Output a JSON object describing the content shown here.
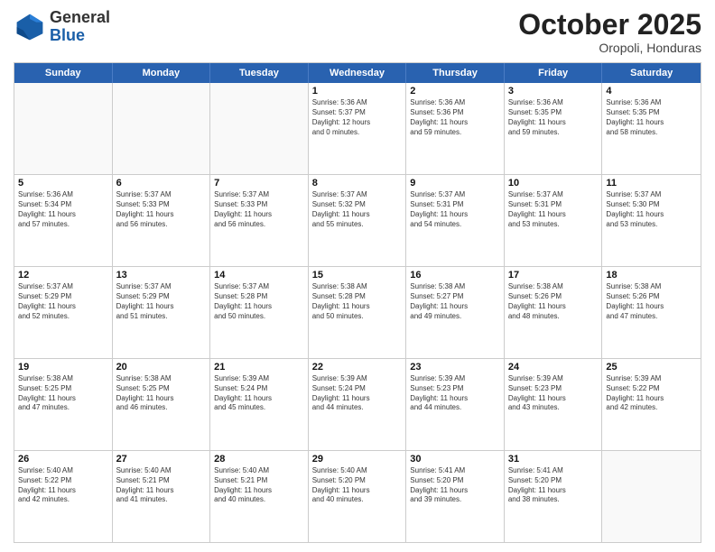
{
  "header": {
    "logo_general": "General",
    "logo_blue": "Blue",
    "month": "October 2025",
    "location": "Oropoli, Honduras"
  },
  "weekdays": [
    "Sunday",
    "Monday",
    "Tuesday",
    "Wednesday",
    "Thursday",
    "Friday",
    "Saturday"
  ],
  "rows": [
    [
      {
        "day": "",
        "text": "",
        "empty": true
      },
      {
        "day": "",
        "text": "",
        "empty": true
      },
      {
        "day": "",
        "text": "",
        "empty": true
      },
      {
        "day": "1",
        "text": "Sunrise: 5:36 AM\nSunset: 5:37 PM\nDaylight: 12 hours\nand 0 minutes."
      },
      {
        "day": "2",
        "text": "Sunrise: 5:36 AM\nSunset: 5:36 PM\nDaylight: 11 hours\nand 59 minutes."
      },
      {
        "day": "3",
        "text": "Sunrise: 5:36 AM\nSunset: 5:35 PM\nDaylight: 11 hours\nand 59 minutes."
      },
      {
        "day": "4",
        "text": "Sunrise: 5:36 AM\nSunset: 5:35 PM\nDaylight: 11 hours\nand 58 minutes."
      }
    ],
    [
      {
        "day": "5",
        "text": "Sunrise: 5:36 AM\nSunset: 5:34 PM\nDaylight: 11 hours\nand 57 minutes."
      },
      {
        "day": "6",
        "text": "Sunrise: 5:37 AM\nSunset: 5:33 PM\nDaylight: 11 hours\nand 56 minutes."
      },
      {
        "day": "7",
        "text": "Sunrise: 5:37 AM\nSunset: 5:33 PM\nDaylight: 11 hours\nand 56 minutes."
      },
      {
        "day": "8",
        "text": "Sunrise: 5:37 AM\nSunset: 5:32 PM\nDaylight: 11 hours\nand 55 minutes."
      },
      {
        "day": "9",
        "text": "Sunrise: 5:37 AM\nSunset: 5:31 PM\nDaylight: 11 hours\nand 54 minutes."
      },
      {
        "day": "10",
        "text": "Sunrise: 5:37 AM\nSunset: 5:31 PM\nDaylight: 11 hours\nand 53 minutes."
      },
      {
        "day": "11",
        "text": "Sunrise: 5:37 AM\nSunset: 5:30 PM\nDaylight: 11 hours\nand 53 minutes."
      }
    ],
    [
      {
        "day": "12",
        "text": "Sunrise: 5:37 AM\nSunset: 5:29 PM\nDaylight: 11 hours\nand 52 minutes."
      },
      {
        "day": "13",
        "text": "Sunrise: 5:37 AM\nSunset: 5:29 PM\nDaylight: 11 hours\nand 51 minutes."
      },
      {
        "day": "14",
        "text": "Sunrise: 5:37 AM\nSunset: 5:28 PM\nDaylight: 11 hours\nand 50 minutes."
      },
      {
        "day": "15",
        "text": "Sunrise: 5:38 AM\nSunset: 5:28 PM\nDaylight: 11 hours\nand 50 minutes."
      },
      {
        "day": "16",
        "text": "Sunrise: 5:38 AM\nSunset: 5:27 PM\nDaylight: 11 hours\nand 49 minutes."
      },
      {
        "day": "17",
        "text": "Sunrise: 5:38 AM\nSunset: 5:26 PM\nDaylight: 11 hours\nand 48 minutes."
      },
      {
        "day": "18",
        "text": "Sunrise: 5:38 AM\nSunset: 5:26 PM\nDaylight: 11 hours\nand 47 minutes."
      }
    ],
    [
      {
        "day": "19",
        "text": "Sunrise: 5:38 AM\nSunset: 5:25 PM\nDaylight: 11 hours\nand 47 minutes."
      },
      {
        "day": "20",
        "text": "Sunrise: 5:38 AM\nSunset: 5:25 PM\nDaylight: 11 hours\nand 46 minutes."
      },
      {
        "day": "21",
        "text": "Sunrise: 5:39 AM\nSunset: 5:24 PM\nDaylight: 11 hours\nand 45 minutes."
      },
      {
        "day": "22",
        "text": "Sunrise: 5:39 AM\nSunset: 5:24 PM\nDaylight: 11 hours\nand 44 minutes."
      },
      {
        "day": "23",
        "text": "Sunrise: 5:39 AM\nSunset: 5:23 PM\nDaylight: 11 hours\nand 44 minutes."
      },
      {
        "day": "24",
        "text": "Sunrise: 5:39 AM\nSunset: 5:23 PM\nDaylight: 11 hours\nand 43 minutes."
      },
      {
        "day": "25",
        "text": "Sunrise: 5:39 AM\nSunset: 5:22 PM\nDaylight: 11 hours\nand 42 minutes."
      }
    ],
    [
      {
        "day": "26",
        "text": "Sunrise: 5:40 AM\nSunset: 5:22 PM\nDaylight: 11 hours\nand 42 minutes."
      },
      {
        "day": "27",
        "text": "Sunrise: 5:40 AM\nSunset: 5:21 PM\nDaylight: 11 hours\nand 41 minutes."
      },
      {
        "day": "28",
        "text": "Sunrise: 5:40 AM\nSunset: 5:21 PM\nDaylight: 11 hours\nand 40 minutes."
      },
      {
        "day": "29",
        "text": "Sunrise: 5:40 AM\nSunset: 5:20 PM\nDaylight: 11 hours\nand 40 minutes."
      },
      {
        "day": "30",
        "text": "Sunrise: 5:41 AM\nSunset: 5:20 PM\nDaylight: 11 hours\nand 39 minutes."
      },
      {
        "day": "31",
        "text": "Sunrise: 5:41 AM\nSunset: 5:20 PM\nDaylight: 11 hours\nand 38 minutes."
      },
      {
        "day": "",
        "text": "",
        "empty": true
      }
    ]
  ]
}
